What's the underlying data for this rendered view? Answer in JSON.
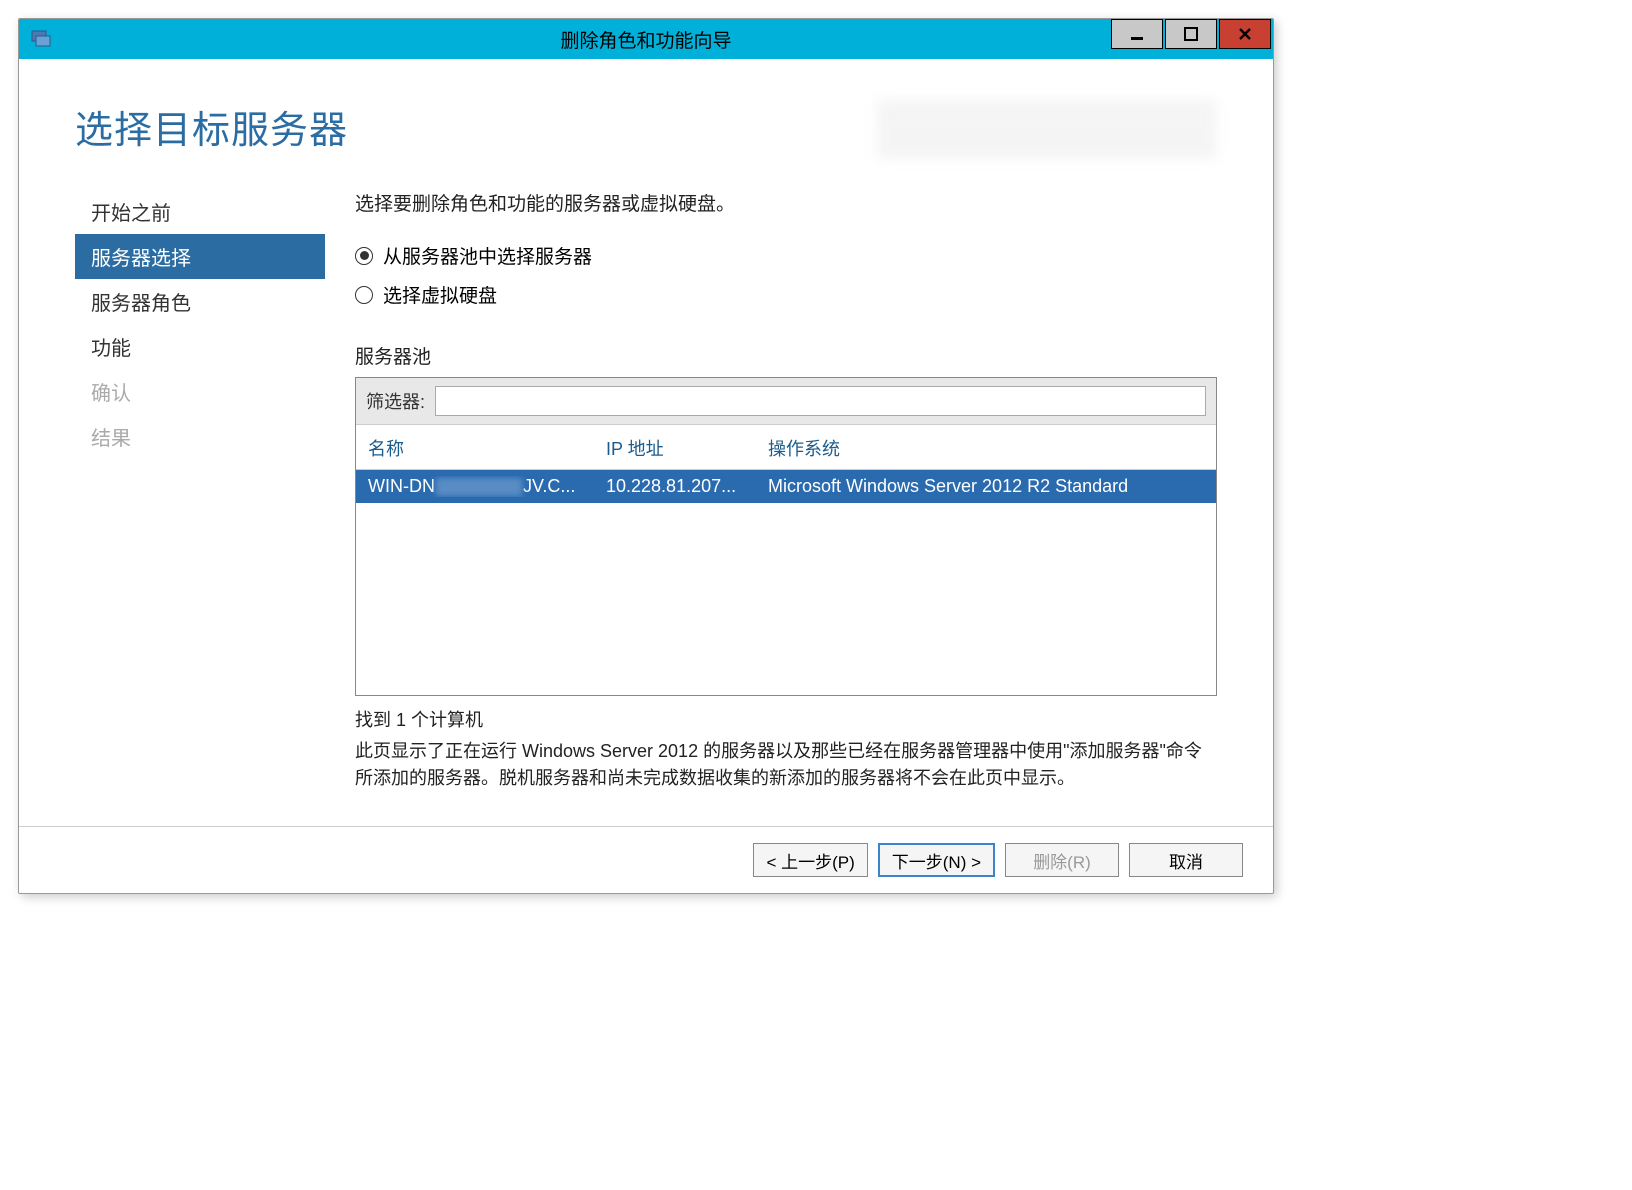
{
  "window": {
    "title": "删除角色和功能向导"
  },
  "header": {
    "page_title": "选择目标服务器"
  },
  "sidebar": {
    "items": [
      {
        "label": "开始之前",
        "selected": false,
        "disabled": false
      },
      {
        "label": "服务器选择",
        "selected": true,
        "disabled": false
      },
      {
        "label": "服务器角色",
        "selected": false,
        "disabled": false
      },
      {
        "label": "功能",
        "selected": false,
        "disabled": false
      },
      {
        "label": "确认",
        "selected": false,
        "disabled": true
      },
      {
        "label": "结果",
        "selected": false,
        "disabled": true
      }
    ]
  },
  "main": {
    "instruction": "选择要删除角色和功能的服务器或虚拟硬盘。",
    "radios": {
      "pool": "从服务器池中选择服务器",
      "vhd": "选择虚拟硬盘",
      "selected": "pool"
    },
    "pool_label": "服务器池",
    "filter_label": "筛选器:",
    "filter_value": "",
    "columns": {
      "name": "名称",
      "ip": "IP 地址",
      "os": "操作系统"
    },
    "rows": [
      {
        "name_prefix": "WIN-DN",
        "name_suffix": "JV.C...",
        "ip": "10.228.81.207...",
        "os": "Microsoft Windows Server 2012 R2 Standard",
        "selected": true
      }
    ],
    "count_text": "找到 1 个计算机",
    "description": "此页显示了正在运行 Windows Server 2012 的服务器以及那些已经在服务器管理器中使用\"添加服务器\"命令所添加的服务器。脱机服务器和尚未完成数据收集的新添加的服务器将不会在此页中显示。"
  },
  "footer": {
    "previous": "< 上一步(P)",
    "next": "下一步(N) >",
    "remove": "删除(R)",
    "cancel": "取消"
  }
}
